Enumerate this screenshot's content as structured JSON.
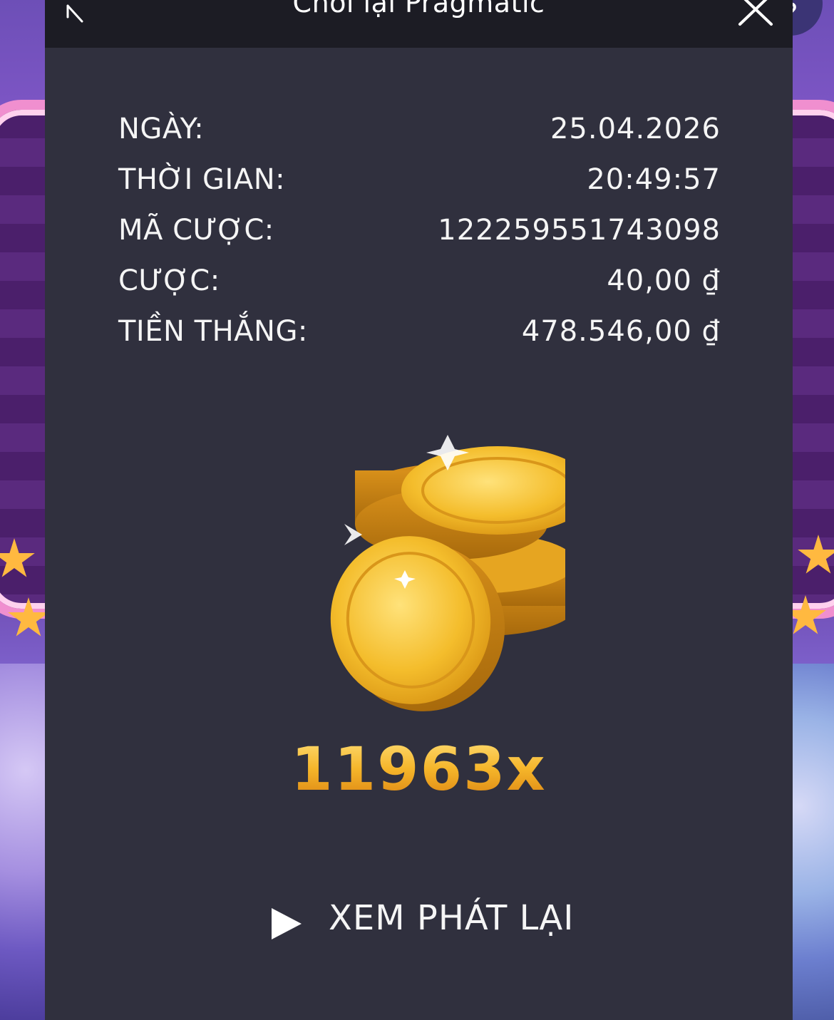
{
  "dialog": {
    "title": "Chơi lại Pragmatic"
  },
  "details": [
    {
      "label": "NGÀY:",
      "value": "25.04.2026"
    },
    {
      "label": "THỜI GIAN:",
      "value": "20:49:57"
    },
    {
      "label": "MÃ CƯỢC:",
      "value": "122259551743098"
    },
    {
      "label": "CƯỢC:",
      "value": "40,00 ₫"
    },
    {
      "label": "TIỀN THẮNG:",
      "value": "478.546,00 ₫"
    }
  ],
  "win": {
    "multiplier": "11963x"
  },
  "replay": {
    "label": "XEM PHÁT LẠI"
  },
  "colors": {
    "dialog_bg": "#30303e",
    "header_bg": "#1c1c24",
    "multiplier_gold": "#f2a41c"
  },
  "icons": [
    "back-icon",
    "close-icon",
    "coins-icon",
    "play-icon"
  ]
}
